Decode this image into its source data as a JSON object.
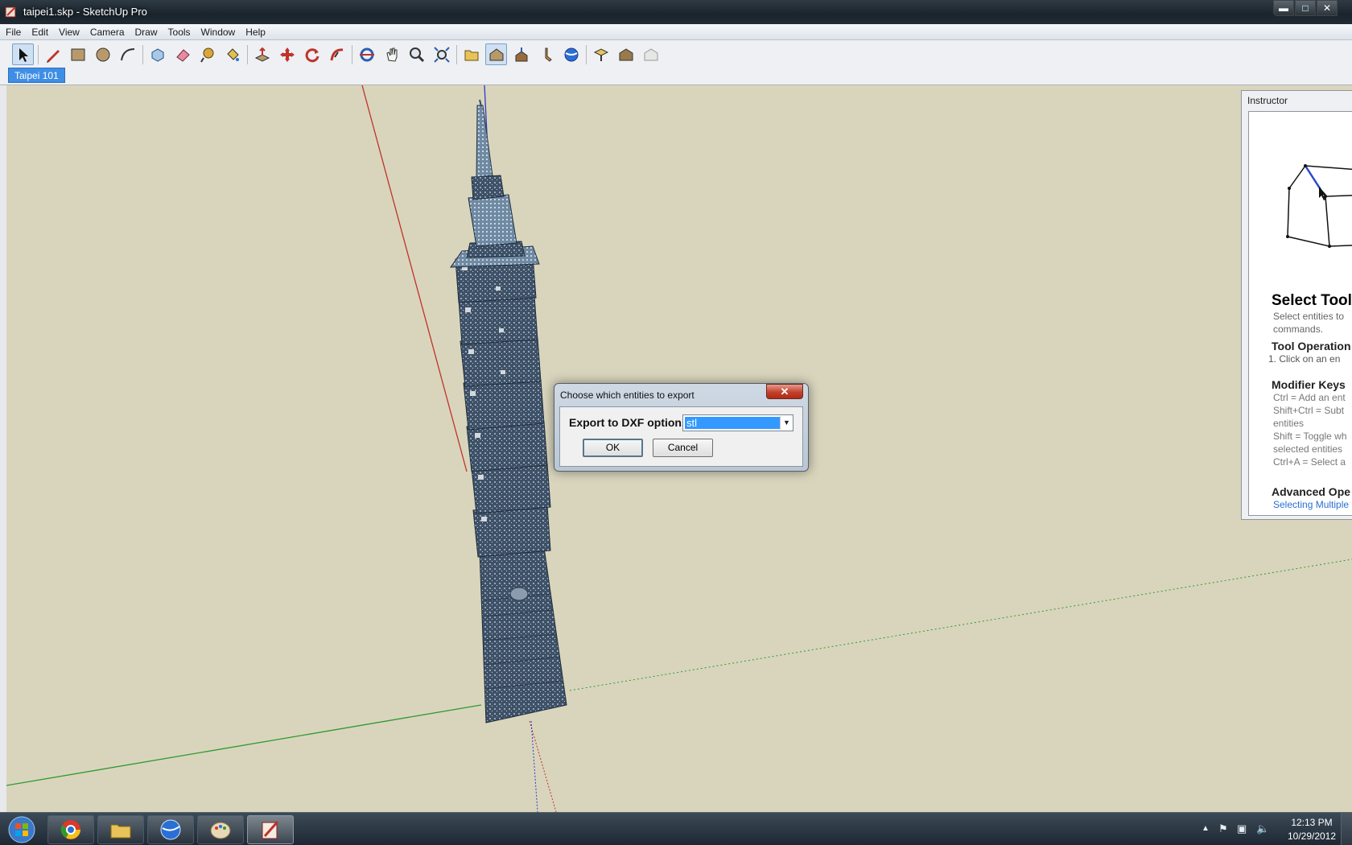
{
  "window": {
    "title": "taipei1.skp - SketchUp Pro",
    "minimize": "▬",
    "maximize": "□",
    "close": "✕"
  },
  "menu": [
    "File",
    "Edit",
    "View",
    "Camera",
    "Draw",
    "Tools",
    "Window",
    "Help"
  ],
  "scene_tab": "Taipei 101",
  "instructor": {
    "title": "Instructor",
    "heading": "Select Tool",
    "desc_line1": "Select entities to",
    "desc_line2": "commands.",
    "tool_operation": "Tool Operation",
    "op_step": "1.   Click on an en",
    "modifier_keys": "Modifier Keys",
    "mk1": "Ctrl = Add an ent",
    "mk2": "Shift+Ctrl = Subt",
    "mk3": "entities",
    "mk4": "Shift = Toggle wh",
    "mk5": "selected entities",
    "mk6": "Ctrl+A = Select a",
    "advanced": "Advanced Ope",
    "link": "Selecting Multiple"
  },
  "dialog": {
    "title": "Choose which entities to export",
    "close": "✕",
    "label": "Export to DXF options",
    "selected": "stl",
    "ok": "OK",
    "cancel": "Cancel"
  },
  "taskbar": {
    "time": "12:13 PM",
    "date": "10/29/2012",
    "tray_arrow": "▲"
  },
  "colors": {
    "viewport": "#d9d5bd",
    "accent": "#3399ff",
    "axis_red": "#c0322a",
    "axis_green": "#2e9a2e",
    "axis_blue": "#2a3acc"
  }
}
